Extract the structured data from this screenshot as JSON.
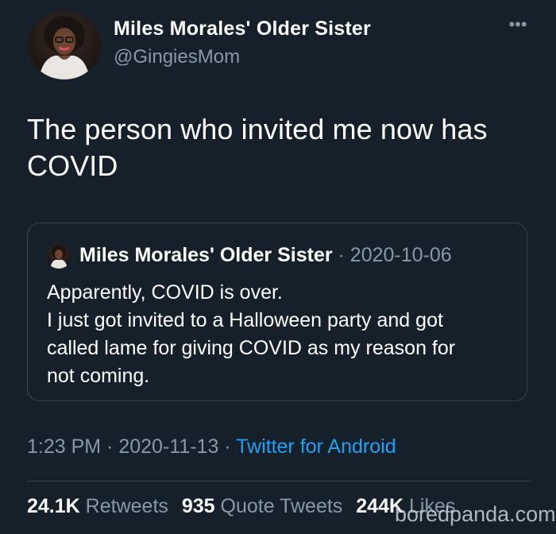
{
  "author": {
    "display_name": "Miles Morales' Older Sister",
    "handle": "@GingiesMom"
  },
  "more_icon": "more-horizontal-icon",
  "tweet": {
    "text_line1": "The person who invited me now has",
    "text_line2": "COVID"
  },
  "quoted_tweet": {
    "display_name": "Miles Morales' Older Sister",
    "separator": " · ",
    "date": "2020-10-06",
    "line1": "Apparently, COVID is over.",
    "line2": "I just got invited to a Halloween party and got",
    "line3": "called lame for giving COVID as my reason for",
    "line4": "not coming."
  },
  "meta": {
    "time": "1:23 PM",
    "sep1": " · ",
    "date": "2020-11-13",
    "sep2": " · ",
    "source": "Twitter for Android"
  },
  "stats": {
    "retweets_count": "24.1K",
    "retweets_label": "Retweets",
    "quotes_count": "935",
    "quotes_label": "Quote Tweets",
    "likes_count": "244K",
    "likes_label": "Likes"
  },
  "watermark": "boredpanda.com",
  "colors": {
    "background": "#15202b",
    "secondary_text": "#8899a6",
    "link": "#1da1f2",
    "border": "#38444d"
  }
}
